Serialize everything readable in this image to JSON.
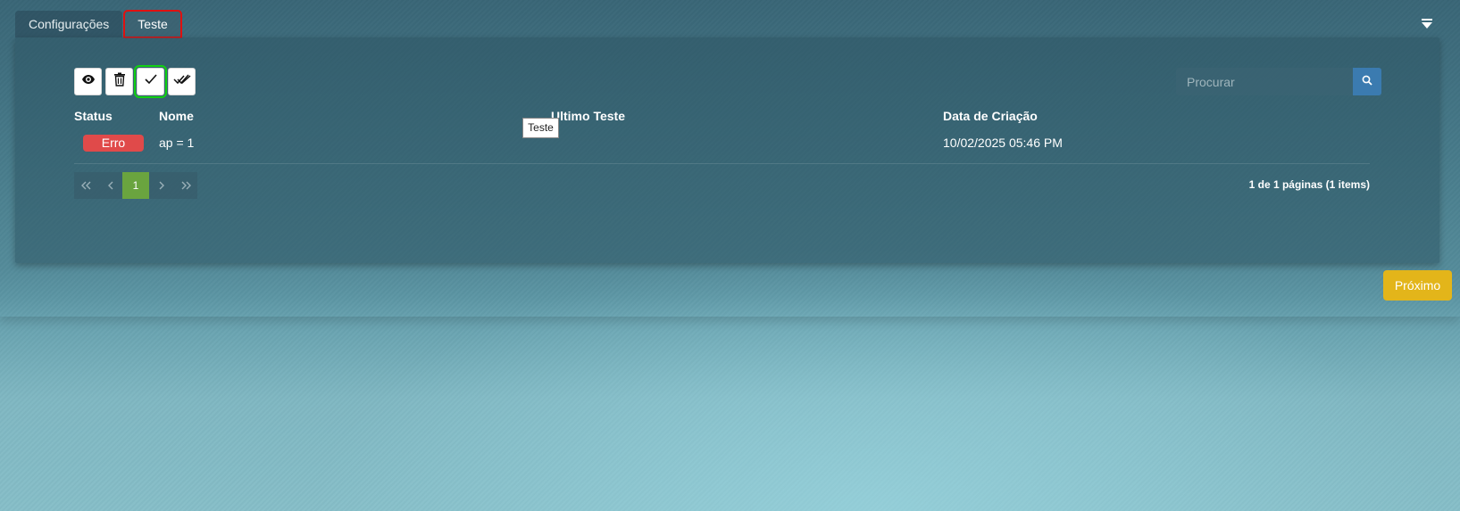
{
  "tabs": [
    {
      "label": "Configurações"
    },
    {
      "label": "Teste"
    }
  ],
  "toolbar": {
    "buttons": [
      {
        "icon": "eye-icon"
      },
      {
        "icon": "trash-icon"
      },
      {
        "icon": "check-icon"
      },
      {
        "icon": "double-check-icon"
      }
    ]
  },
  "search": {
    "placeholder": "Procurar"
  },
  "table": {
    "headers": [
      "Status",
      "Nome",
      "Ultimo Teste",
      "Data de Criação"
    ],
    "rows": [
      {
        "status": "Erro",
        "nome": "ap = 1",
        "ultimo_teste": "",
        "data_criacao": "10/02/2025 05:46 PM"
      }
    ]
  },
  "tooltip": {
    "text": "Teste"
  },
  "pagination": {
    "current_page": "1",
    "info": "1 de 1 páginas (1 items)"
  },
  "footer": {
    "next_label": "Próximo"
  },
  "colors": {
    "status_error": "#e04a4a",
    "page_active": "#6aa43f",
    "next_button": "#e3b51a",
    "search_button": "#3b7bb0",
    "active_tab_highlight": "#e01010",
    "selected_tool_highlight": "#12d012"
  }
}
